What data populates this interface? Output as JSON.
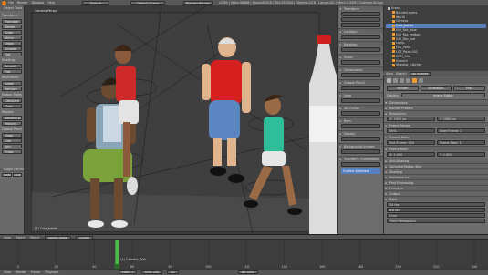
{
  "app": {
    "info_header": [
      "File",
      "Render",
      "Window",
      "Help"
    ],
    "layout": "Default",
    "scene": "Default Scene",
    "engine": "Blender Render",
    "stats": "v2.69 | Verts:38868 | Faces:80516 | Tris:157404 | Objects:0/16 | Lamps:0/1 | Mem:1.00M | Clothbar-Stripped"
  },
  "tool_shelf": {
    "title": "Object Tools",
    "sections": [
      {
        "label": "Transform:",
        "items": [
          "Translate",
          "Rotate",
          "Scale"
        ]
      },
      {
        "label": "",
        "items": [
          "Mirror"
        ]
      },
      {
        "label": "",
        "items": [
          "Origin",
          "Smooth",
          "Flat"
        ]
      },
      {
        "label": "Shading:",
        "items": [
          "Smooth",
          "Flat"
        ]
      },
      {
        "label": "Keyframes:",
        "items": [
          "Insert",
          "Remove"
        ]
      },
      {
        "label": "Motion Paths:",
        "items": [
          "Calculate",
          "Clear"
        ]
      },
      {
        "label": "Repeat:",
        "items": [
          "Repeat Last",
          "History..."
        ]
      },
      {
        "label": "Grease Pencil:",
        "items": [
          "Draw",
          "Line",
          "Poly",
          "Erase"
        ]
      }
    ],
    "bottom_panel": "Toggle Editmode",
    "bottom_options": [
      "Toggle",
      "Local"
    ]
  },
  "viewport": {
    "label": "Camera Persp",
    "object_label": "(1) Cola_bottle",
    "header_items": [
      "View",
      "Select",
      "Object",
      "Object Mode",
      "Global"
    ]
  },
  "n_panel": {
    "sections": [
      {
        "title": "Transform",
        "open": true
      },
      {
        "title": "Location:",
        "open": false
      },
      {
        "title": "Rotation:",
        "open": false
      },
      {
        "title": "Scale:",
        "open": false
      },
      {
        "title": "Dimensions:",
        "open": false
      },
      {
        "title": "Grease Pencil",
        "open": false
      },
      {
        "title": "View",
        "open": false
      },
      {
        "title": "3D Cursor",
        "open": false
      },
      {
        "title": "Item",
        "open": false
      },
      {
        "title": "Display",
        "open": false
      },
      {
        "title": "Background Images",
        "open": false
      },
      {
        "title": "Transform Orientations",
        "open": false
      }
    ],
    "highlight": "Outline Selected"
  },
  "outliner": {
    "header": [
      "View",
      "Search",
      "All Scenes"
    ],
    "items": [
      "Scene",
      "RenderLayers",
      "World",
      "Camera",
      "Cola_bottle",
      "Girl_Roc_blue",
      "Girl_Roc_redtop",
      "Girl_Roc_red",
      "Lamp",
      "LCT_Paint",
      "LCT_Paint.001",
      "RNM_Sim",
      "Ground",
      "Shadow_Catcher"
    ]
  },
  "properties": {
    "tabs": [
      "Render",
      "Animation",
      "Play"
    ],
    "render_row": [
      "Render",
      "Animation",
      "Play"
    ],
    "display": "Image Editor",
    "sections": [
      {
        "title": "Dimensions",
        "open": true
      },
      {
        "title": "Render Presets",
        "open": false
      },
      {
        "title": "Resolution:",
        "open": false
      },
      {
        "title": "Frame Range:",
        "open": false
      },
      {
        "title": "Aspect Ratio:",
        "open": false
      },
      {
        "title": "Frame Rate:",
        "open": false
      },
      {
        "title": "Anti-Aliasing",
        "open": false
      },
      {
        "title": "Sampled Motion Blur",
        "open": false
      },
      {
        "title": "Shading",
        "open": false
      },
      {
        "title": "Performance",
        "open": false
      },
      {
        "title": "Post Processing",
        "open": false
      },
      {
        "title": "Freestyle",
        "open": false
      },
      {
        "title": "Output",
        "open": false
      },
      {
        "title": "Bake",
        "open": false
      }
    ],
    "fields": {
      "res_x": "X: 1920 px",
      "res_y": "Y: 1080 px",
      "res_pct": "50%",
      "start": "Start Frame: 1",
      "end": "End Frame: 250",
      "step": "Frame Step: 1",
      "asp_x": "X: 1.000",
      "asp_y": "Y: 1.000",
      "fps": "24 fps",
      "border": "Border",
      "crop": "Crop",
      "time": "Time Remapping"
    }
  },
  "timeline": {
    "header": [
      "View",
      "Marker",
      "Frame",
      "Playback"
    ],
    "start": "Start: 1",
    "end": "End: 250",
    "current": "52",
    "marker": "(1) Camera_000",
    "ticks": [
      "0",
      "20",
      "40",
      "60",
      "80",
      "100",
      "120",
      "140",
      "160",
      "180",
      "200",
      "220",
      "240"
    ],
    "sync": "No Sync"
  },
  "colors": {
    "bg": "#3a3a3a",
    "accent_orange": "#f09a34",
    "selected_blue": "#5680c2",
    "playhead_green": "#4ed04a"
  }
}
